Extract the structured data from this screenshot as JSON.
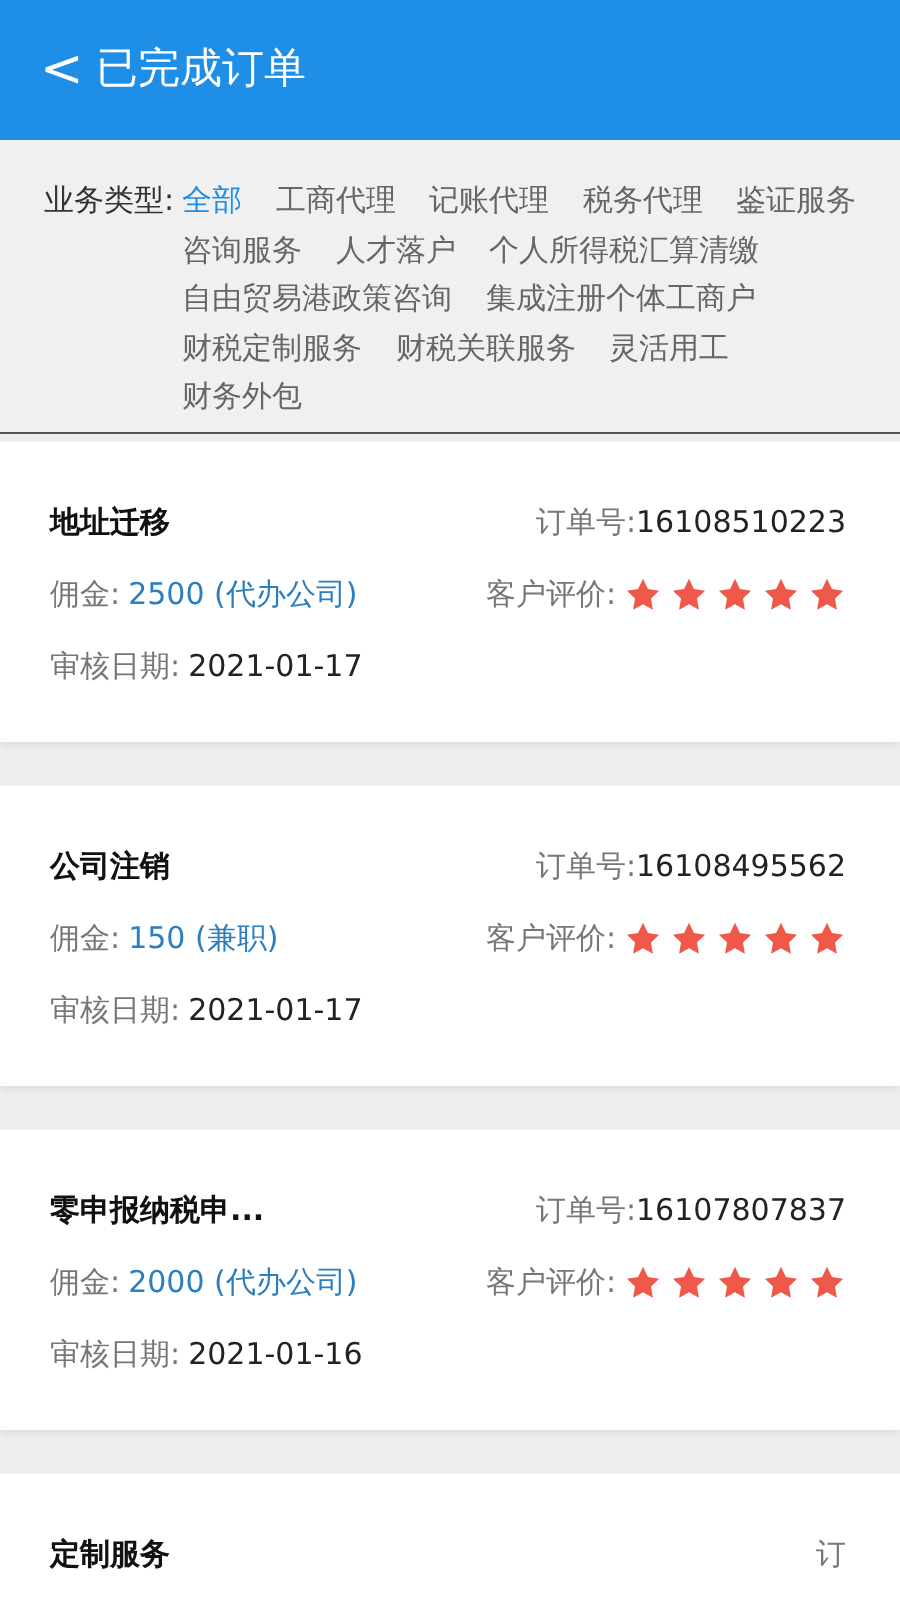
{
  "header": {
    "back_icon": "<",
    "title": "已完成订单"
  },
  "filter": {
    "label": "业务类型:",
    "options": [
      {
        "label": "全部",
        "selected": true
      },
      {
        "label": "工商代理",
        "selected": false
      },
      {
        "label": "记账代理",
        "selected": false
      },
      {
        "label": "税务代理",
        "selected": false
      },
      {
        "label": "鉴证服务",
        "selected": false
      },
      {
        "label": "咨询服务",
        "selected": false
      },
      {
        "label": "人才落户",
        "selected": false
      },
      {
        "label": "个人所得税汇算清缴",
        "selected": false
      },
      {
        "label": "自由贸易港政策咨询",
        "selected": false
      },
      {
        "label": "集成注册个体工商户",
        "selected": false
      },
      {
        "label": "财税定制服务",
        "selected": false
      },
      {
        "label": "财税关联服务",
        "selected": false
      },
      {
        "label": "灵活用工",
        "selected": false
      },
      {
        "label": "财务外包",
        "selected": false
      }
    ]
  },
  "orders": [
    {
      "title": "地址迁移",
      "order_label": "订单号:",
      "order_no": "16108510223",
      "commission_label": "佣金:",
      "commission": "2500 (代办公司)",
      "rating_label": "客户评价:",
      "stars": 5,
      "date_label": "审核日期:",
      "date": "2021-01-17"
    },
    {
      "title": "公司注销",
      "order_label": "订单号:",
      "order_no": "16108495562",
      "commission_label": "佣金:",
      "commission": "150 (兼职)",
      "rating_label": "客户评价:",
      "stars": 5,
      "date_label": "审核日期:",
      "date": "2021-01-17"
    },
    {
      "title": "零申报纳税申...",
      "order_label": "订单号:",
      "order_no": "16107807837",
      "commission_label": "佣金:",
      "commission": "2000 (代办公司)",
      "rating_label": "客户评价:",
      "stars": 5,
      "date_label": "审核日期:",
      "date": "2021-01-16"
    },
    {
      "title": "定制服务",
      "order_label": "订"
    }
  ]
}
